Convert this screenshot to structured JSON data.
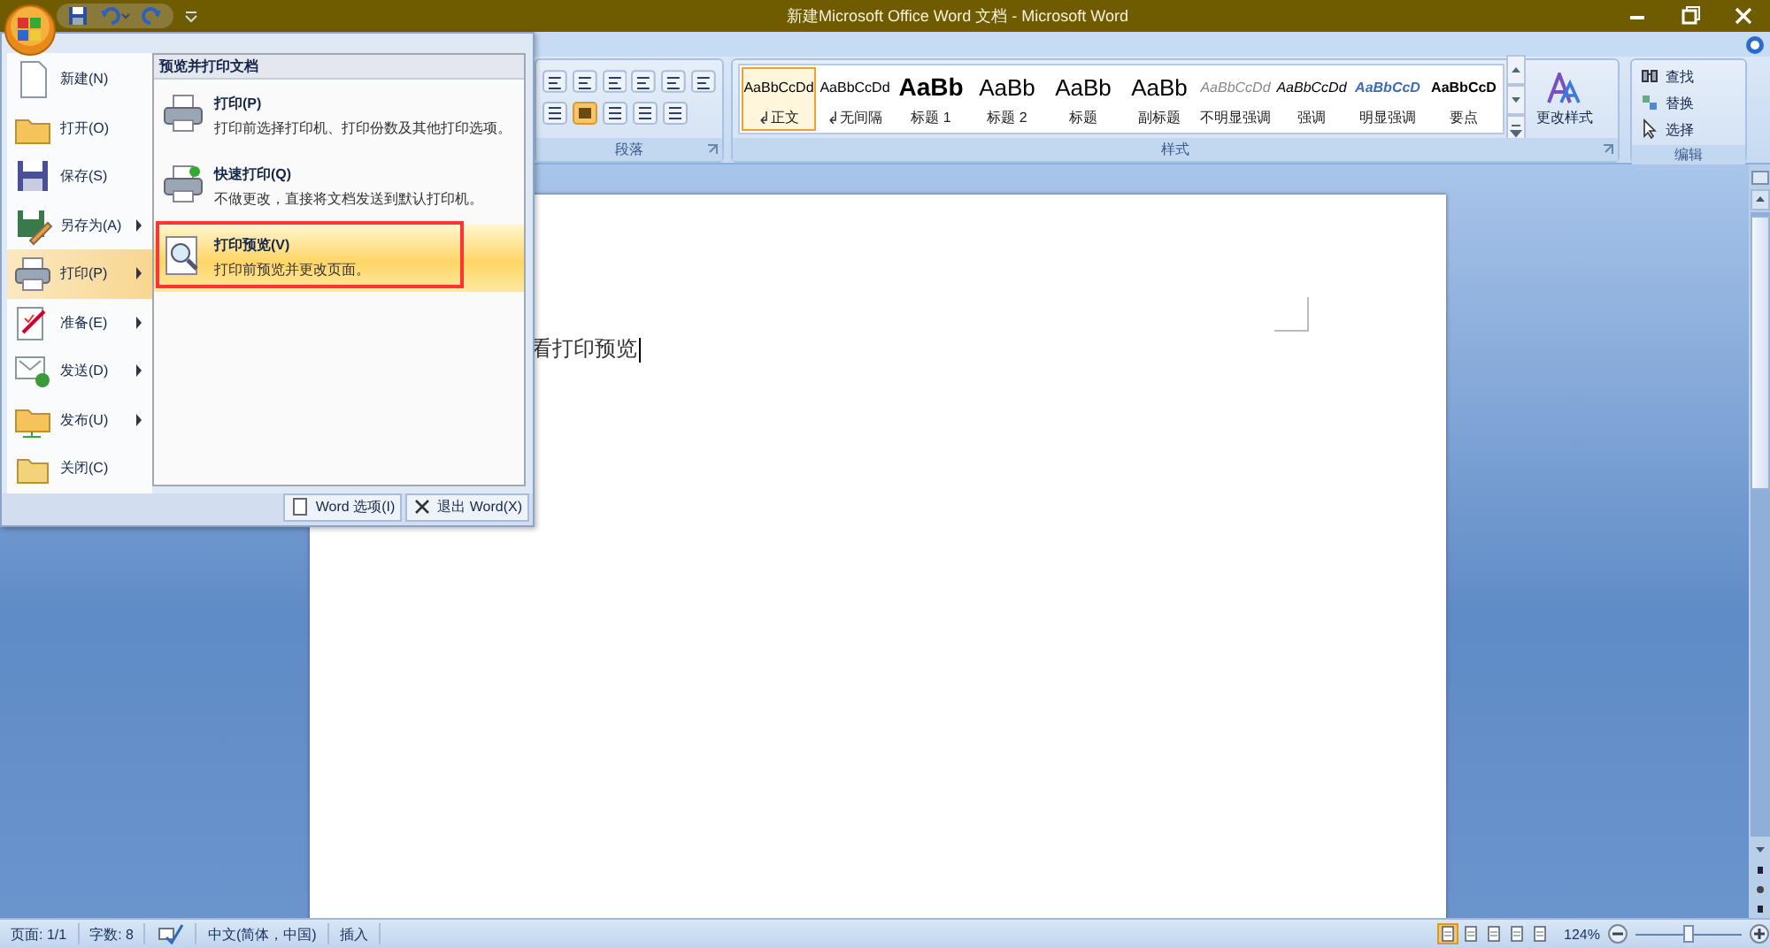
{
  "window": {
    "title": "新建Microsoft Office Word 文档 - Microsoft Word"
  },
  "ribbon": {
    "paragraph_group": {
      "label": "段落"
    },
    "styles_group": {
      "label": "样式",
      "change_styles": "更改样式",
      "styles": [
        {
          "preview": "AaBbCcDd",
          "name": "正文",
          "kind": "normal",
          "paragraph_mark": true,
          "selected": true
        },
        {
          "preview": "AaBbCcDd",
          "name": "无间隔",
          "kind": "normal",
          "paragraph_mark": true,
          "selected": false
        },
        {
          "preview": "AaBb",
          "name": "标题 1",
          "kind": "heading1",
          "paragraph_mark": false,
          "selected": false
        },
        {
          "preview": "AaBb",
          "name": "标题 2",
          "kind": "heading2",
          "paragraph_mark": false,
          "selected": false
        },
        {
          "preview": "AaBb",
          "name": "标题",
          "kind": "heading2",
          "paragraph_mark": false,
          "selected": false
        },
        {
          "preview": "AaBb",
          "name": "副标题",
          "kind": "heading2",
          "paragraph_mark": false,
          "selected": false
        },
        {
          "preview": "AaBbCcDd",
          "name": "不明显强调",
          "kind": "subtle",
          "paragraph_mark": false,
          "selected": false
        },
        {
          "preview": "AaBbCcDd",
          "name": "强调",
          "kind": "emphasis",
          "paragraph_mark": false,
          "selected": false
        },
        {
          "preview": "AaBbCcD",
          "name": "明显强调",
          "kind": "intense",
          "paragraph_mark": false,
          "selected": false
        },
        {
          "preview": "AaBbCcD",
          "name": "要点",
          "kind": "strong",
          "paragraph_mark": false,
          "selected": false
        }
      ]
    },
    "editing_group": {
      "label": "编辑",
      "items": [
        "查找",
        "替换",
        "选择"
      ]
    }
  },
  "document": {
    "text": "看打印预览"
  },
  "office_menu": {
    "items": [
      {
        "label": "新建(N)",
        "has_submenu": false,
        "selected": false
      },
      {
        "label": "打开(O)",
        "has_submenu": false,
        "selected": false
      },
      {
        "label": "保存(S)",
        "has_submenu": false,
        "selected": false
      },
      {
        "label": "另存为(A)",
        "has_submenu": true,
        "selected": false
      },
      {
        "label": "打印(P)",
        "has_submenu": true,
        "selected": true
      },
      {
        "label": "准备(E)",
        "has_submenu": true,
        "selected": false
      },
      {
        "label": "发送(D)",
        "has_submenu": true,
        "selected": false
      },
      {
        "label": "发布(U)",
        "has_submenu": true,
        "selected": false
      },
      {
        "label": "关闭(C)",
        "has_submenu": false,
        "selected": false
      }
    ],
    "submenu": {
      "title": "预览并打印文档",
      "items": [
        {
          "title": "打印(P)",
          "description": "打印前选择打印机、打印份数及其他打印选项。",
          "selected": false
        },
        {
          "title": "快速打印(Q)",
          "description": "不做更改，直接将文档发送到默认打印机。",
          "selected": false
        },
        {
          "title": "打印预览(V)",
          "description": "打印前预览并更改页面。",
          "selected": true
        }
      ]
    },
    "buttons": [
      "Word 选项(I)",
      "退出 Word(X)"
    ]
  },
  "status_bar": {
    "page": "页面: 1/1",
    "words": "字数: 8",
    "language": "中文(简体，中国)",
    "mode": "插入",
    "view_buttons": [
      {
        "selected": true
      },
      {
        "selected": false
      },
      {
        "selected": false
      },
      {
        "selected": false
      },
      {
        "selected": false
      }
    ],
    "zoom": "124%",
    "zoom_slider": {
      "level": 0.5
    }
  }
}
